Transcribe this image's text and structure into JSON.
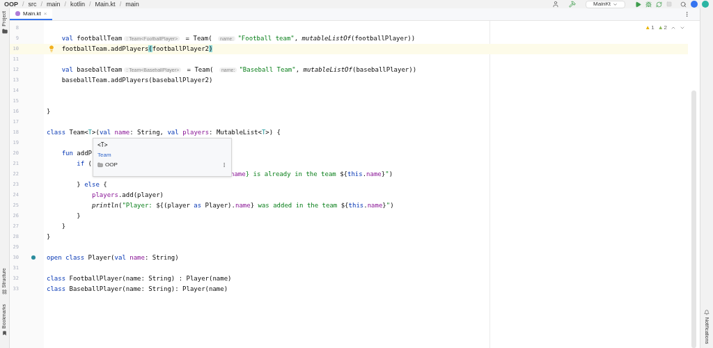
{
  "breadcrumbs": [
    "OOP",
    "src",
    "main",
    "kotlin",
    "Main.kt",
    "main"
  ],
  "breadcrumb_separator": "/",
  "run_config": {
    "label": "MainKt"
  },
  "tabs": [
    {
      "label": "Main.kt",
      "selected": true,
      "close": "×"
    }
  ],
  "left_tools": [
    "Project"
  ],
  "left_tools_bottom": [
    "Structure",
    "Bookmarks"
  ],
  "right_tools": [
    "Notifications"
  ],
  "inspections": [
    {
      "kind": "warning",
      "icon": "▲",
      "count": "1"
    },
    {
      "kind": "weak",
      "icon": "▲",
      "count": "2"
    }
  ],
  "lines": [
    {
      "n": "8",
      "kind": "code"
    },
    {
      "n": "9",
      "kind": "code",
      "spans": [
        {
          "kind": "kw",
          "text": "    val "
        },
        {
          "kind": "pl",
          "text": "footballTeam"
        },
        {
          "kind": "hint",
          "text": ": Team<FootballPlayer>"
        },
        {
          "kind": "pl",
          "text": " = Team( "
        },
        {
          "kind": "hint",
          "text": "name:"
        },
        {
          "kind": "str",
          "text": "\"Football team\""
        },
        {
          "kind": "pl",
          "text": ", "
        },
        {
          "kind": "fn",
          "text": "mutableListOf"
        },
        {
          "kind": "pl",
          "text": "(footballPlayer))"
        }
      ]
    },
    {
      "n": "10",
      "kind": "current",
      "bulb": true,
      "spans": [
        {
          "kind": "pl",
          "text": "    footballTeam.addPlayers"
        },
        {
          "kind": "br",
          "text": "("
        },
        {
          "kind": "pl",
          "text": "footballPlayer2"
        },
        {
          "kind": "br",
          "text": ")"
        }
      ]
    },
    {
      "n": "11",
      "kind": "code"
    },
    {
      "n": "12",
      "kind": "code",
      "spans": [
        {
          "kind": "kw",
          "text": "    val "
        },
        {
          "kind": "pl",
          "text": "baseballTeam"
        },
        {
          "kind": "hint",
          "text": ": Team<BaseballPlayer>"
        },
        {
          "kind": "pl",
          "text": " = Team( "
        },
        {
          "kind": "hint",
          "text": "name:"
        },
        {
          "kind": "str",
          "text": "\"Baseball Team\""
        },
        {
          "kind": "pl",
          "text": ", "
        },
        {
          "kind": "fn",
          "text": "mutableListOf"
        },
        {
          "kind": "pl",
          "text": "(baseballPlayer))"
        }
      ]
    },
    {
      "n": "13",
      "kind": "code",
      "spans": [
        {
          "kind": "pl",
          "text": "    baseballTeam.addPlayers(baseballPlayer2)"
        }
      ]
    },
    {
      "n": "14",
      "kind": "code"
    },
    {
      "n": "15",
      "kind": "code"
    },
    {
      "n": "16",
      "kind": "code",
      "spans": [
        {
          "kind": "pl",
          "text": "}"
        }
      ]
    },
    {
      "n": "17",
      "kind": "code"
    },
    {
      "n": "18",
      "kind": "code",
      "spans": [
        {
          "kind": "kw",
          "text": "class "
        },
        {
          "kind": "pl",
          "text": "Team<"
        },
        {
          "kind": "tp",
          "text": "T"
        },
        {
          "kind": "pl",
          "text": ">("
        },
        {
          "kind": "kw",
          "text": "val "
        },
        {
          "kind": "prop",
          "text": "name"
        },
        {
          "kind": "pl",
          "text": ": String, "
        },
        {
          "kind": "kw",
          "text": "val "
        },
        {
          "kind": "prop",
          "text": "players"
        },
        {
          "kind": "pl",
          "text": ": MutableList<"
        },
        {
          "kind": "tp",
          "text": "T"
        },
        {
          "kind": "pl",
          "text": ">) {"
        }
      ]
    },
    {
      "n": "19",
      "kind": "code"
    },
    {
      "n": "20",
      "kind": "code",
      "spans": [
        {
          "kind": "kw",
          "text": "    fun "
        },
        {
          "kind": "pl",
          "text": "addP"
        }
      ]
    },
    {
      "n": "21",
      "kind": "code",
      "spans": [
        {
          "kind": "kw",
          "text": "        if "
        },
        {
          "kind": "pl",
          "text": "("
        }
      ]
    },
    {
      "n": "22",
      "kind": "covered",
      "spans": [
        {
          "kind": "prop",
          "text": "name"
        },
        {
          "kind": "str",
          "text": "} is already in the team "
        },
        {
          "kind": "pl",
          "text": "${"
        },
        {
          "kind": "kw",
          "text": "this"
        },
        {
          "kind": "pl",
          "text": "."
        },
        {
          "kind": "prop",
          "text": "name"
        },
        {
          "kind": "pl",
          "text": "}"
        },
        {
          "kind": "str",
          "text": "\""
        },
        {
          "kind": "pl",
          "text": ")"
        }
      ]
    },
    {
      "n": "23",
      "kind": "code",
      "spans": [
        {
          "kind": "pl",
          "text": "        } "
        },
        {
          "kind": "kw",
          "text": "else "
        },
        {
          "kind": "pl",
          "text": "{"
        }
      ]
    },
    {
      "n": "24",
      "kind": "code",
      "spans": [
        {
          "kind": "prop",
          "text": "            players"
        },
        {
          "kind": "pl",
          "text": ".add(player)"
        }
      ]
    },
    {
      "n": "25",
      "kind": "code",
      "spans": [
        {
          "kind": "fn",
          "text": "            println"
        },
        {
          "kind": "pl",
          "text": "("
        },
        {
          "kind": "str",
          "text": "\"Player: "
        },
        {
          "kind": "pl",
          "text": "${(player "
        },
        {
          "kind": "kw",
          "text": "as "
        },
        {
          "kind": "pl",
          "text": "Player)."
        },
        {
          "kind": "prop",
          "text": "name"
        },
        {
          "kind": "pl",
          "text": "}"
        },
        {
          "kind": "str",
          "text": " was added in the team "
        },
        {
          "kind": "pl",
          "text": "${"
        },
        {
          "kind": "kw",
          "text": "this"
        },
        {
          "kind": "pl",
          "text": "."
        },
        {
          "kind": "prop",
          "text": "name"
        },
        {
          "kind": "pl",
          "text": "}"
        },
        {
          "kind": "str",
          "text": "\""
        },
        {
          "kind": "pl",
          "text": ")"
        }
      ]
    },
    {
      "n": "26",
      "kind": "code",
      "spans": [
        {
          "kind": "pl",
          "text": "        }"
        }
      ]
    },
    {
      "n": "27",
      "kind": "code",
      "spans": [
        {
          "kind": "pl",
          "text": "    }"
        }
      ]
    },
    {
      "n": "28",
      "kind": "code",
      "spans": [
        {
          "kind": "pl",
          "text": "}"
        }
      ]
    },
    {
      "n": "29",
      "kind": "code"
    },
    {
      "n": "30",
      "kind": "code",
      "gutter_icon": true,
      "spans": [
        {
          "kind": "kw",
          "text": "open class "
        },
        {
          "kind": "pl",
          "text": "Player("
        },
        {
          "kind": "kw",
          "text": "val "
        },
        {
          "kind": "prop",
          "text": "name"
        },
        {
          "kind": "pl",
          "text": ": String)"
        }
      ]
    },
    {
      "n": "31",
      "kind": "code"
    },
    {
      "n": "32",
      "kind": "code",
      "spans": [
        {
          "kind": "kw",
          "text": "class "
        },
        {
          "kind": "pl",
          "text": "FootballPlayer(name: String) : Player(name)"
        }
      ]
    },
    {
      "n": "33",
      "kind": "code",
      "spans": [
        {
          "kind": "kw",
          "text": "class "
        },
        {
          "kind": "pl",
          "text": "BaseballPlayer(name: String): Player(name)"
        }
      ]
    }
  ],
  "popup": {
    "title": "<T>",
    "class_name": "Team",
    "module": "OOP"
  }
}
